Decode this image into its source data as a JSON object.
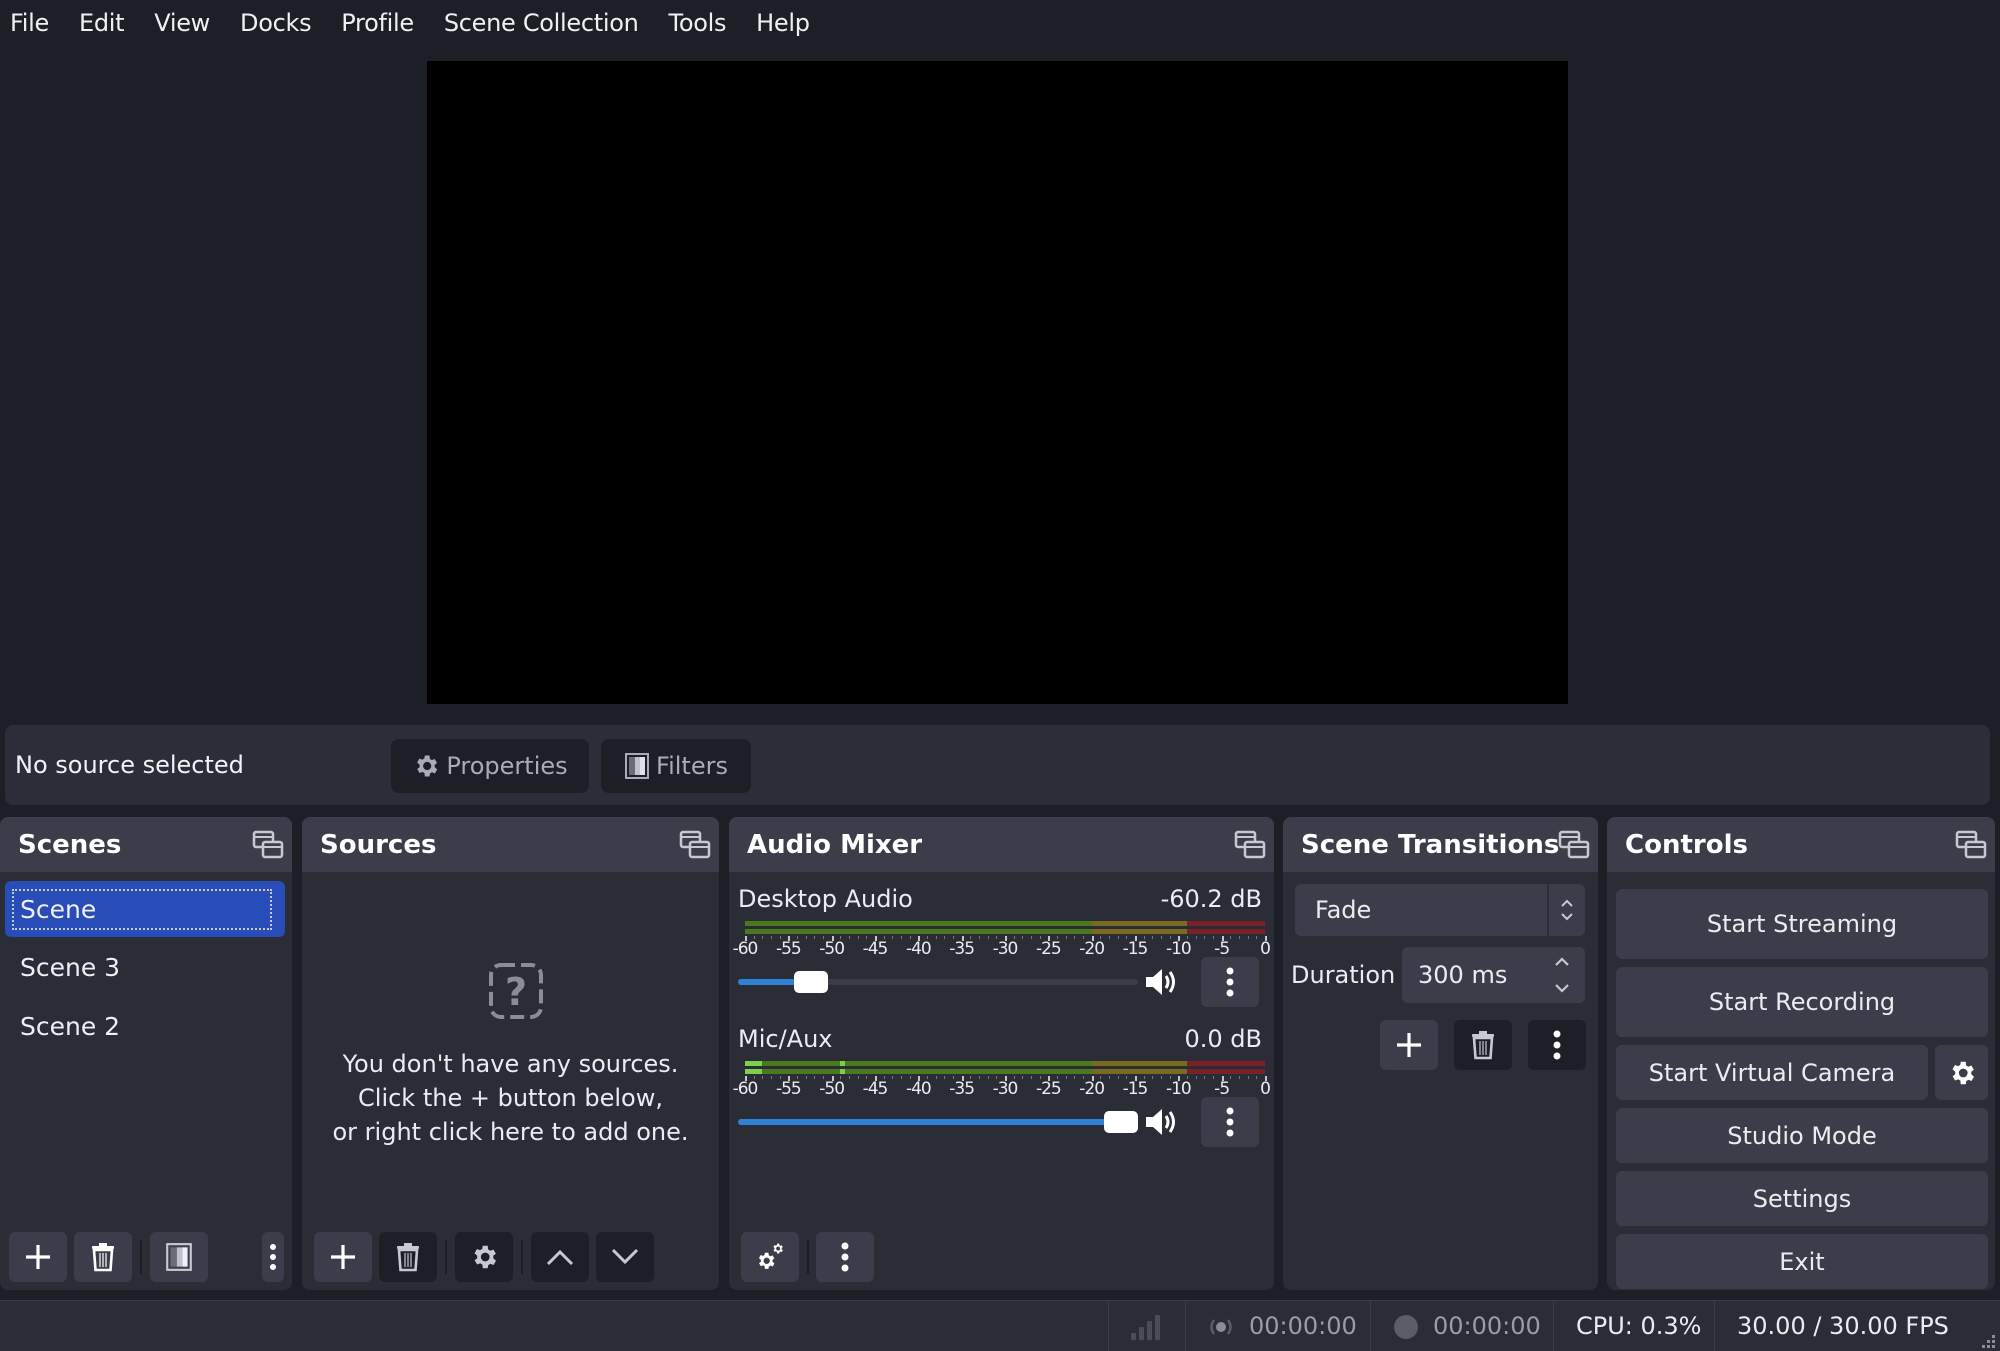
{
  "menu": [
    "File",
    "Edit",
    "View",
    "Docks",
    "Profile",
    "Scene Collection",
    "Tools",
    "Help"
  ],
  "source_bar": {
    "status": "No source selected",
    "properties_label": "Properties",
    "filters_label": "Filters"
  },
  "scenes": {
    "title": "Scenes",
    "items": [
      {
        "label": "Scene",
        "selected": true
      },
      {
        "label": "Scene 3",
        "selected": false
      },
      {
        "label": "Scene 2",
        "selected": false
      }
    ]
  },
  "sources": {
    "title": "Sources",
    "empty_line1": "You don't have any sources.",
    "empty_line2": "Click the + button below,",
    "empty_line3": "or right click here to add one."
  },
  "mixer": {
    "title": "Audio Mixer",
    "scale_ticks": [
      "-60",
      "-55",
      "-50",
      "-45",
      "-40",
      "-35",
      "-30",
      "-25",
      "-20",
      "-15",
      "-10",
      "-5",
      "0"
    ],
    "channels": [
      {
        "name": "Desktop Audio",
        "db": "-60.2 dB",
        "volume_fraction": 0.14,
        "muted": false,
        "level_db": null
      },
      {
        "name": "Mic/Aux",
        "db": "0.0 dB",
        "volume_fraction": 1.0,
        "muted": false,
        "level_db": -58
      }
    ],
    "meter_colors": {
      "green": "#4a7a1e",
      "yellow": "#7a6a20",
      "red": "#7a2026",
      "active": "#7ed04a"
    }
  },
  "transitions": {
    "title": "Scene Transitions",
    "selected": "Fade",
    "duration_label": "Duration",
    "duration_value": "300 ms"
  },
  "controls": {
    "title": "Controls",
    "start_streaming": "Start Streaming",
    "start_recording": "Start Recording",
    "start_virtual_camera": "Start Virtual Camera",
    "studio_mode": "Studio Mode",
    "settings": "Settings",
    "exit": "Exit"
  },
  "status": {
    "stream_time": "00:00:00",
    "record_time": "00:00:00",
    "cpu": "CPU: 0.3%",
    "fps": "30.00 / 30.00 FPS"
  },
  "colors": {
    "background": "#1d1f27",
    "panel": "#2a2c36",
    "panel_header": "#3b3e4a",
    "selection": "#284cb8",
    "slider_fill": "#2f82d8"
  }
}
